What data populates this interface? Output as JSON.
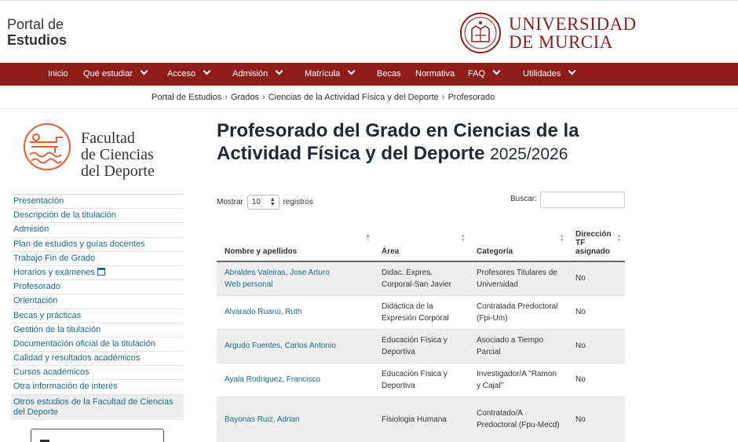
{
  "header": {
    "portal_line1": "Portal de",
    "portal_line2": "Estudios",
    "university_line1": "UNIVERSIDAD",
    "university_line2": "DE MURCIA",
    "brand_color": "#8d1d16"
  },
  "nav": {
    "items": [
      {
        "label": "Inicio",
        "dropdown": false
      },
      {
        "label": "Qué estudiar",
        "dropdown": true
      },
      {
        "label": "Acceso",
        "dropdown": true
      },
      {
        "label": "Admisión",
        "dropdown": true
      },
      {
        "label": "Matrícula",
        "dropdown": true
      },
      {
        "label": "Becas",
        "dropdown": false
      },
      {
        "label": "Normativa",
        "dropdown": false
      },
      {
        "label": "FAQ",
        "dropdown": true
      },
      {
        "label": "Utilidades",
        "dropdown": true
      }
    ]
  },
  "breadcrumb": [
    "Portal de Estudios",
    "Grados",
    "Ciencias de la Actividad Física y del Deporte",
    "Profesorado"
  ],
  "faculty": {
    "line1": "Facultad",
    "line2": "de Ciencias",
    "line3": "del Deporte",
    "logo_color": "#e0603a"
  },
  "sidebar": {
    "items": [
      "Presentación",
      "Descripción de la titulación",
      "Admisión",
      "Plan de estudios y guías docentes",
      "Trabajo Fin de Grado",
      "Horarios y exámenes",
      "Profesorado",
      "Orientación",
      "Becas y prácticas",
      "Gestión de la titulación",
      "Documentación oficial de la titulación",
      "Calidad y resultados académicos",
      "Cursos académicos",
      "Otra información de interés",
      "Otros estudios de la Facultad de Ciencias del Deporte"
    ],
    "link_color": "#1a6a8a"
  },
  "main": {
    "title": "Profesorado del Grado en Ciencias de la Actividad Física y del Deporte",
    "year": "2025/2026",
    "show_label": "Mostrar",
    "show_value": "10",
    "records_label": "registros",
    "search_label": "Buscar:",
    "search_value": "",
    "columns": [
      "Nombre y apellidos",
      "Área",
      "Categoría",
      "Dirección TF asignado"
    ],
    "rows": [
      {
        "name": "Abraldes Valeiras, Jose Arturo",
        "link2": "Web personal",
        "area": "Didac. Expres. Corporal-San Javier",
        "category": "Profesores Titulares de Universidad",
        "tf": "No"
      },
      {
        "name": "Alvarado Ruano, Ruth",
        "link2": "",
        "area": "Didáctica de la Expresión Corporal",
        "category": "Contratada Predoctoral (Fpi-Um)",
        "tf": "No"
      },
      {
        "name": "Argudo Fuentes, Carlos Antonio",
        "link2": "",
        "area": "Educación Física y Deportiva",
        "category": "Asociado a Tiempo Parcial",
        "tf": "No"
      },
      {
        "name": "Ayala Rodriguez, Francisco",
        "link2": "",
        "area": "Educación Física y Deportiva",
        "category": "Investigador/A \"Ramon y Cajal\"",
        "tf": "No"
      },
      {
        "name": "Bayonas Ruiz, Adrian",
        "link2": "",
        "area": "Fisiologia Humana",
        "category": "Contratado/A Predoctoral (Fpu-Mecd)",
        "tf": "No"
      }
    ]
  }
}
